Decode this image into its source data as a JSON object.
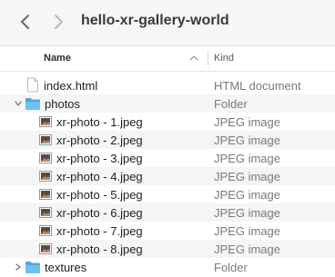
{
  "window": {
    "title": "hello-xr-gallery-world"
  },
  "columns": {
    "name": "Name",
    "kind": "Kind"
  },
  "rows": [
    {
      "name": "index.html",
      "kind": "HTML document",
      "type": "file"
    },
    {
      "name": "photos",
      "kind": "Folder",
      "type": "folder",
      "expanded": true
    },
    {
      "name": "xr-photo - 1.jpeg",
      "kind": "JPEG image",
      "type": "image"
    },
    {
      "name": "xr-photo - 2.jpeg",
      "kind": "JPEG image",
      "type": "image"
    },
    {
      "name": "xr-photo - 3.jpeg",
      "kind": "JPEG image",
      "type": "image"
    },
    {
      "name": "xr-photo - 4.jpeg",
      "kind": "JPEG image",
      "type": "image"
    },
    {
      "name": "xr-photo - 5.jpeg",
      "kind": "JPEG image",
      "type": "image"
    },
    {
      "name": "xr-photo - 6.jpeg",
      "kind": "JPEG image",
      "type": "image"
    },
    {
      "name": "xr-photo - 7.jpeg",
      "kind": "JPEG image",
      "type": "image"
    },
    {
      "name": "xr-photo - 8.jpeg",
      "kind": "JPEG image",
      "type": "image"
    },
    {
      "name": "textures",
      "kind": "Folder",
      "type": "folder",
      "expanded": false
    }
  ],
  "icons": {
    "back": "chevron-left-icon",
    "forward": "chevron-right-icon",
    "sort": "chevron-up-icon",
    "folder": "folder-icon",
    "file": "document-icon",
    "image": "image-file-icon"
  },
  "colors": {
    "folder": "#5ab3ea",
    "alt_row": "#f4f5f5",
    "toolbar": "#f6f6f6"
  }
}
